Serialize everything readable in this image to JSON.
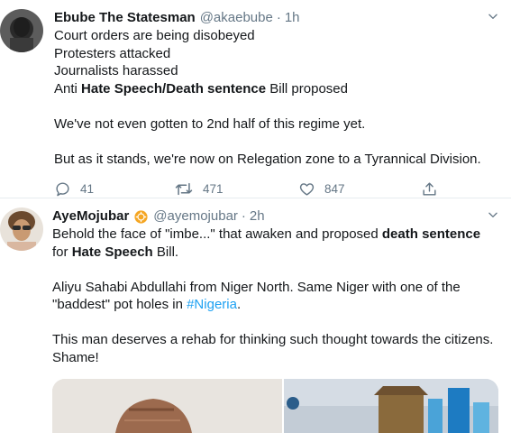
{
  "tweets": [
    {
      "author": {
        "name": "Ebube The Statesman",
        "handle": "@akaebube"
      },
      "dot": "·",
      "time": "1h",
      "lines": [
        "Court orders are being disobeyed",
        "Protesters attacked",
        "Journalists harassed"
      ],
      "line4": {
        "prefix": "Anti ",
        "bold": "Hate Speech/Death sentence",
        "suffix": " Bill proposed"
      },
      "para2": "We've not even gotten to 2nd half of this regime yet.",
      "para3": "But as it stands, we're now on Relegation zone to a Tyrannical Division.",
      "stats": {
        "replies": "41",
        "retweets": "471",
        "likes": "847"
      }
    },
    {
      "author": {
        "name": "AyeMojubar",
        "handle": "@ayemojubar"
      },
      "dot": "·",
      "time": "2h",
      "p1": {
        "a": "Behold the face of \"imbe...\" that awaken and proposed ",
        "b": "death sentence",
        "c": " for ",
        "d": "Hate Speech",
        "e": " Bill."
      },
      "p2": {
        "a": "Aliyu Sahabi Abdullahi from Niger North. Same Niger with one of the \"baddest\" pot holes in ",
        "hashtag": "#Nigeria",
        "b": "."
      },
      "p3": "This man deserves a rehab for thinking such thought towards the citizens. Shame!",
      "media_count": 2
    }
  ],
  "colors": {
    "text": "#14171a",
    "secondary": "#657786",
    "link": "#1da1f2",
    "divider": "#e6ecf0",
    "badge": "#f5a623"
  },
  "icons": [
    "chevron-down-icon",
    "reply-icon",
    "retweet-icon",
    "like-icon",
    "share-icon",
    "badge-icon"
  ]
}
